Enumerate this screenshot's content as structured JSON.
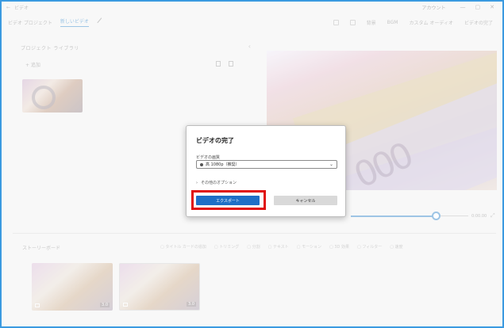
{
  "titlebar": {
    "app_name": "ビデオ",
    "account": "アカウント",
    "minimize": "—",
    "maximize": "▢",
    "close": "✕"
  },
  "toolbar": {
    "crumbs": [
      "ビデオ プロジェクト",
      "新しいビデオ"
    ],
    "actions": [
      "背景",
      "BGM",
      "カスタム オーディオ",
      "ビデオの完了"
    ]
  },
  "library": {
    "heading": "プロジェクト ライブラリ",
    "add_label": "+ 追加"
  },
  "preview": {
    "time_label": "0:00.00"
  },
  "storyboard": {
    "title": "ストーリーボード",
    "tools": [
      "タイトル カードの追加",
      "トリミング",
      "分割",
      "テキスト",
      "モーション",
      "3D 効果",
      "フィルター",
      "速度"
    ],
    "clips": [
      {
        "duration": "3.0"
      },
      {
        "duration": "3.0"
      }
    ]
  },
  "dialog": {
    "title": "ビデオの完了",
    "quality_label": "ビデオの画質",
    "quality_value": "高 1080p（推奨）",
    "more_options": "その他のオプション",
    "export_label": "エクスポート",
    "cancel_label": "キャンセル"
  },
  "colors": {
    "accent": "#1f6fc6",
    "highlight": "#e01010",
    "frame": "#3b9ae0"
  }
}
